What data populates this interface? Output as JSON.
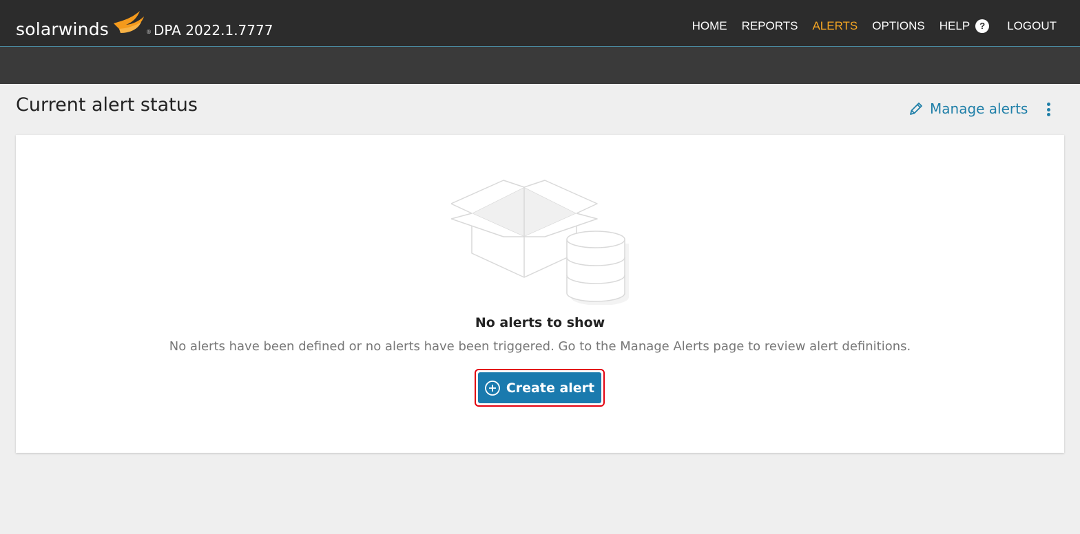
{
  "header": {
    "brand": "solarwinds",
    "version": "DPA 2022.1.7777",
    "nav": [
      {
        "label": "HOME",
        "active": false
      },
      {
        "label": "REPORTS",
        "active": false
      },
      {
        "label": "ALERTS",
        "active": true
      },
      {
        "label": "OPTIONS",
        "active": false
      },
      {
        "label": "HELP",
        "active": false,
        "icon": "help-icon"
      },
      {
        "label": "LOGOUT",
        "active": false
      }
    ],
    "help_icon_glyph": "?"
  },
  "page": {
    "title": "Current alert status",
    "manage_label": "Manage alerts",
    "manage_icon": "pencil-icon",
    "more_icon": "kebab-menu-icon"
  },
  "empty_state": {
    "title": "No alerts to show",
    "description": "No alerts have been defined or no alerts have been triggered. Go to the Manage Alerts page to review alert definitions.",
    "button_label": "Create alert",
    "button_icon": "plus-circle-icon",
    "illustration": "empty-box-database-illustration"
  },
  "colors": {
    "topbar": "#2c2c2c",
    "subbar": "#3a3a3a",
    "accent_active": "#f5a623",
    "link": "#1f7fa8",
    "button": "#1a7aae",
    "highlight": "#e3000f"
  }
}
